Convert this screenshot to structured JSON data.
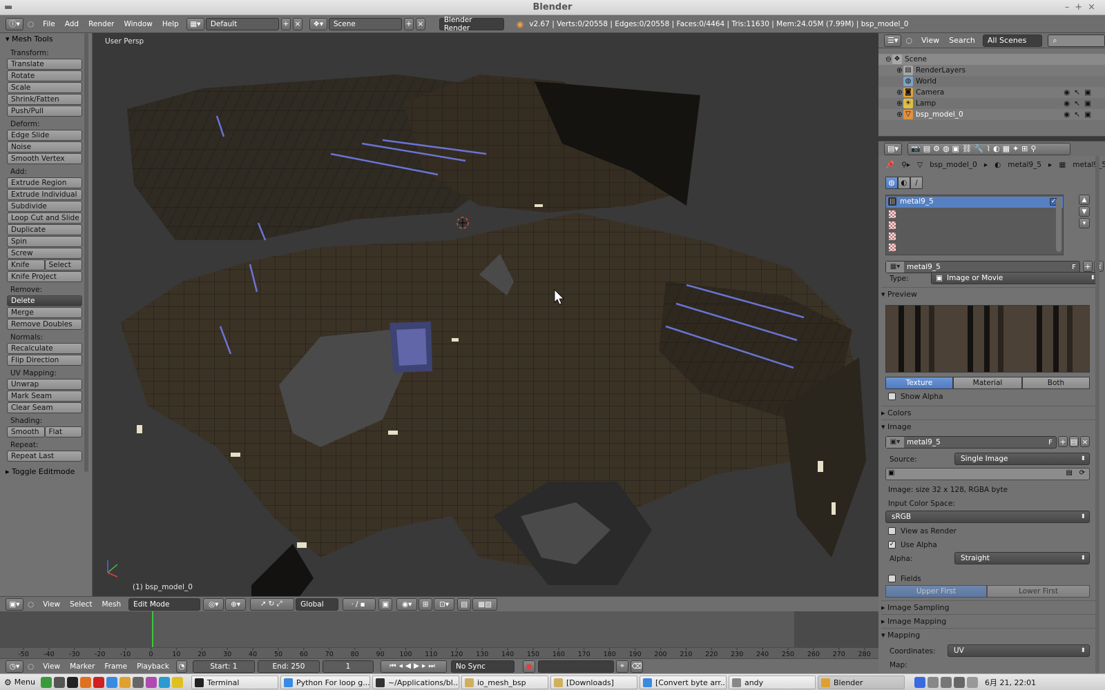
{
  "window": {
    "title": "Blender"
  },
  "info_header": {
    "menus": [
      "File",
      "Add",
      "Render",
      "Window",
      "Help"
    ],
    "screen_layout": "Default",
    "scene": "Scene",
    "render_engine": "Blender Render",
    "stats": "v2.67 | Verts:0/20558 | Edges:0/20558 | Faces:0/4464 | Tris:11630 | Mem:24.05M (7.99M) | bsp_model_0"
  },
  "toolshelf": {
    "title": "Mesh Tools",
    "transform_label": "Transform:",
    "transform": [
      "Translate",
      "Rotate",
      "Scale",
      "Shrink/Fatten",
      "Push/Pull"
    ],
    "deform_label": "Deform:",
    "deform": [
      "Edge Slide",
      "Noise",
      "Smooth Vertex"
    ],
    "add_label": "Add:",
    "add": [
      "Extrude Region",
      "Extrude Individual",
      "Subdivide",
      "Loop Cut and Slide",
      "Duplicate",
      "Spin",
      "Screw"
    ],
    "knife": "Knife",
    "select": "Select",
    "knife_project": "Knife Project",
    "remove_label": "Remove:",
    "delete": "Delete",
    "remove": [
      "Merge",
      "Remove Doubles"
    ],
    "normals_label": "Normals:",
    "normals": [
      "Recalculate",
      "Flip Direction"
    ],
    "uv_label": "UV Mapping:",
    "uv": [
      "Unwrap",
      "Mark Seam",
      "Clear Seam"
    ],
    "shading_label": "Shading:",
    "smooth": "Smooth",
    "flat": "Flat",
    "repeat_label": "Repeat:",
    "repeat_last": "Repeat Last",
    "toggle_editmode": "Toggle Editmode"
  },
  "viewport": {
    "view_name": "User Persp",
    "object_label": "(1) bsp_model_0"
  },
  "view3d_header": {
    "menus": [
      "View",
      "Select",
      "Mesh"
    ],
    "mode": "Edit Mode",
    "orientation": "Global"
  },
  "timeline": {
    "ticks": [
      "-50",
      "-40",
      "-30",
      "-20",
      "-10",
      "0",
      "10",
      "20",
      "30",
      "40",
      "50",
      "60",
      "70",
      "80",
      "90",
      "100",
      "110",
      "120",
      "130",
      "140",
      "150",
      "160",
      "170",
      "180",
      "190",
      "200",
      "210",
      "220",
      "230",
      "240",
      "250",
      "260",
      "270",
      "280"
    ],
    "menus": [
      "View",
      "Marker",
      "Frame",
      "Playback"
    ],
    "start": "Start: 1",
    "end": "End: 250",
    "current": "1",
    "sync": "No Sync"
  },
  "outliner": {
    "menus": [
      "View",
      "Search"
    ],
    "filter": "All Scenes",
    "items": [
      "Scene",
      "RenderLayers",
      "World",
      "Camera",
      "Lamp",
      "bsp_model_0"
    ]
  },
  "properties": {
    "breadcrumb": [
      "bsp_model_0",
      "metal9_5",
      "metal9_5"
    ],
    "texture_slot_selected": "metal9_5",
    "texture_name": "metal9_5",
    "type_label": "Type:",
    "type_value": "Image or Movie",
    "preview_panel": "Preview",
    "preview_tabs": [
      "Texture",
      "Material",
      "Both"
    ],
    "show_alpha": "Show Alpha",
    "colors_panel": "Colors",
    "image_panel": "Image",
    "image_name": "metal9_5",
    "source_label": "Source:",
    "source_value": "Single Image",
    "image_info": "Image: size 32 x 128, RGBA byte",
    "input_color_space_label": "Input Color Space:",
    "input_color_space": "sRGB",
    "view_as_render": "View as Render",
    "use_alpha": "Use Alpha",
    "alpha_label": "Alpha:",
    "alpha_value": "Straight",
    "fields": "Fields",
    "field_order": [
      "Upper First",
      "Lower First"
    ],
    "image_sampling_panel": "Image Sampling",
    "image_mapping_panel": "Image Mapping",
    "mapping_panel": "Mapping",
    "coordinates_label": "Coordinates:",
    "coordinates_value": "UV",
    "map_label": "Map:"
  },
  "taskbar": {
    "menu": "Menu",
    "tasks": [
      "Terminal",
      "Python For loop g...",
      "~/Applications/bl...",
      "io_mesh_bsp",
      "[Downloads]",
      "[Convert byte arr...",
      "andy",
      "Blender"
    ],
    "clock": "6月 21, 22:01"
  }
}
